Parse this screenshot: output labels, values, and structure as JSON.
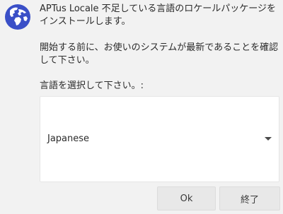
{
  "dialog": {
    "icon": "globe-icon",
    "intro_lines": [
      "APTus Locale 不足している言語のロケールパッケージを",
      "インストールします。"
    ],
    "notice_lines": [
      "開始する前に、お使いのシステムが最新であることを確認",
      "して下さい。"
    ],
    "prompt": "言語を選択して下さい。:",
    "select": {
      "value": "Japanese"
    },
    "buttons": {
      "ok": "Ok",
      "quit": "終了"
    },
    "colors": {
      "globe_bg": "#3a4fc7",
      "globe_land": "#ffffff"
    }
  }
}
